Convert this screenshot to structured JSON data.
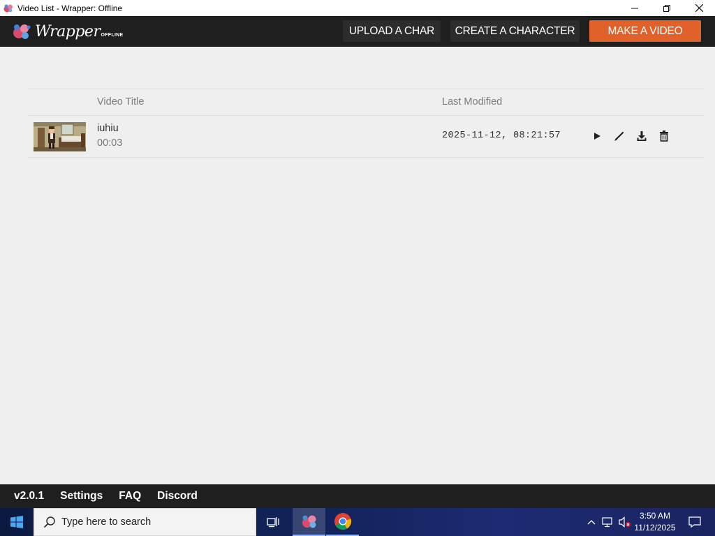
{
  "window": {
    "title": "Video List - Wrapper: Offline",
    "controls": {
      "minimize": "─",
      "restore": "❐",
      "close": "✕"
    }
  },
  "header": {
    "logo_word": "Wrapper",
    "logo_sub": "OFFLINE",
    "buttons": {
      "upload": "UPLOAD A CHAR",
      "create": "CREATE A CHARACTER",
      "make": "MAKE A VIDEO"
    },
    "colors": {
      "bar": "#1f1f1f",
      "accent": "#e0612a"
    }
  },
  "table": {
    "columns": {
      "title": "Video Title",
      "modified": "Last Modified"
    },
    "rows": [
      {
        "title": "iuhiu",
        "duration": "00:03",
        "modified": "2025-11-12, 08:21:57",
        "actions": [
          "play-icon",
          "edit-icon",
          "download-icon",
          "delete-icon"
        ]
      }
    ]
  },
  "footer": {
    "version": "v2.0.1",
    "settings": "Settings",
    "faq": "FAQ",
    "discord": "Discord"
  },
  "taskbar": {
    "search_placeholder": "Type here to search",
    "pinned": [
      "task-view-icon",
      "wrapper-app-icon",
      "chrome-icon"
    ],
    "clock": {
      "time": "3:50 AM",
      "date": "11/12/2025"
    },
    "tray": [
      "chevron-up-icon",
      "network-icon",
      "volume-muted-icon",
      "notification-icon"
    ]
  }
}
